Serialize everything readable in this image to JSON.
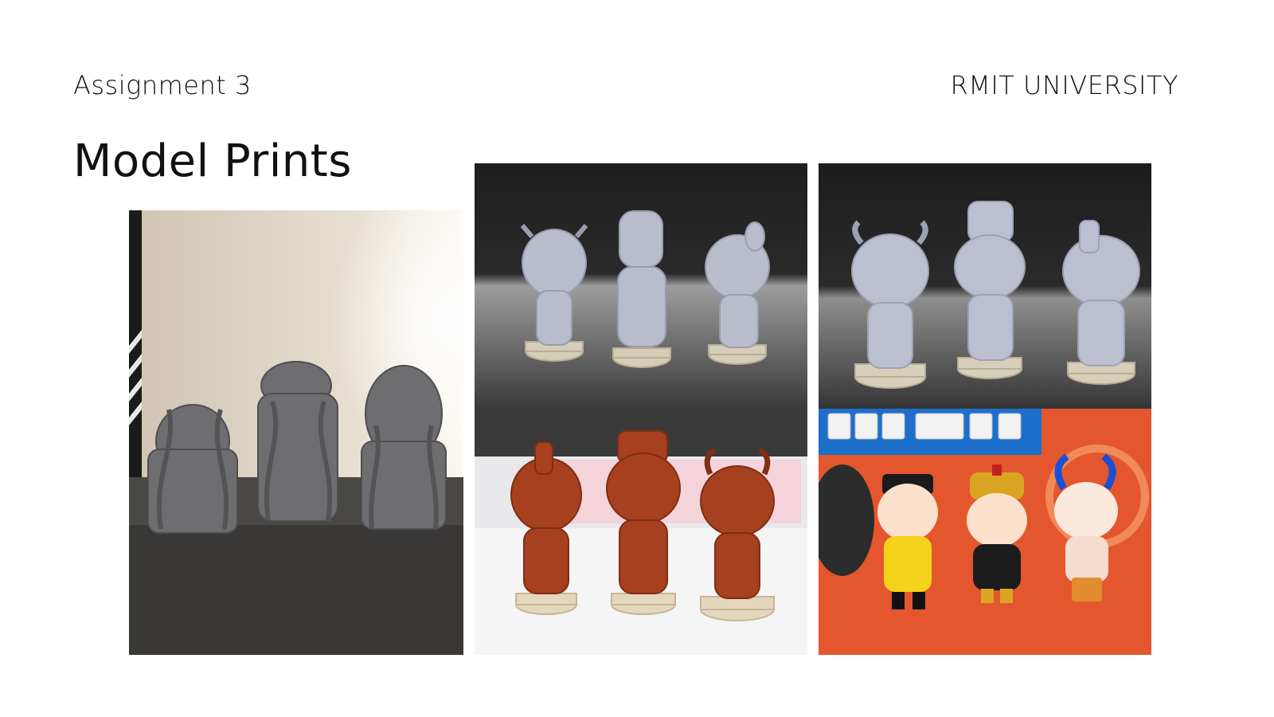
{
  "header": {
    "left_label": "Assignment 3",
    "right_label": "RMIT UNIVERSITY"
  },
  "page": {
    "title": "Model Prints"
  },
  "photos": [
    {
      "subject": "three grey raw prints with support structures on printer bed"
    },
    {
      "subject": "three light grey resin figurines, rear view"
    },
    {
      "subject": "three light grey resin figurines, front view"
    },
    {
      "subject": "three red-brown figurines on beige bases"
    },
    {
      "subject": "three painted figurines on orange desk mat"
    }
  ]
}
